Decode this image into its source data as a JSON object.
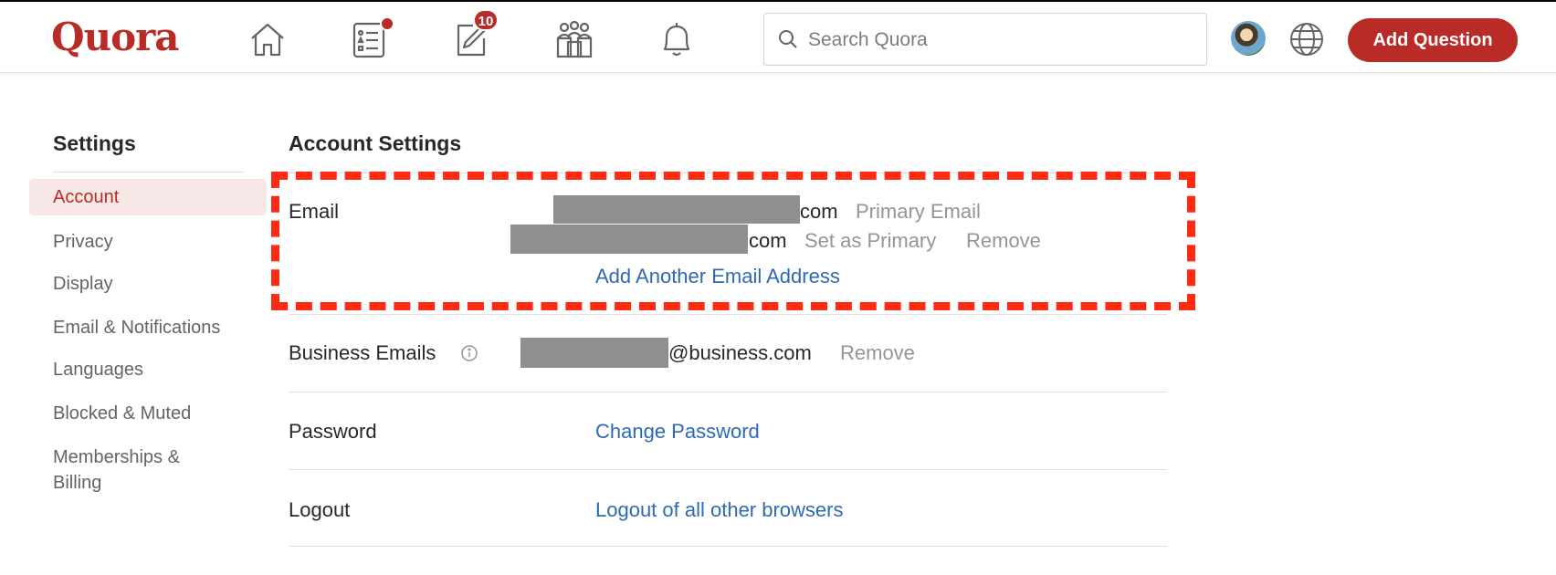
{
  "header": {
    "logo": "Quora",
    "nav": [
      {
        "name": "home",
        "icon": "home-icon"
      },
      {
        "name": "following",
        "icon": "list-icon",
        "has_dot": true
      },
      {
        "name": "answer",
        "icon": "edit-icon",
        "badge": "10"
      },
      {
        "name": "spaces",
        "icon": "people-icon"
      },
      {
        "name": "notifications",
        "icon": "bell-icon"
      }
    ],
    "search": {
      "placeholder": "Search Quora",
      "value": ""
    },
    "add_question_label": "Add Question",
    "brand_color": "#b92b27"
  },
  "sidebar": {
    "title": "Settings",
    "items": [
      {
        "label": "Account",
        "active": true
      },
      {
        "label": "Privacy",
        "active": false
      },
      {
        "label": "Display",
        "active": false
      },
      {
        "label": "Email & Notifications",
        "active": false
      },
      {
        "label": "Languages",
        "active": false
      },
      {
        "label": "Blocked & Muted",
        "active": false
      },
      {
        "label": "Memberships &",
        "label_line2": "Billing",
        "active": false
      }
    ]
  },
  "main": {
    "title": "Account Settings",
    "email": {
      "label": "Email",
      "primary_suffix": "com",
      "primary_tag": "Primary Email",
      "secondary_suffix": "com",
      "set_primary_label": "Set as Primary",
      "remove_label": "Remove",
      "add_label": "Add Another Email Address"
    },
    "business": {
      "label": "Business Emails",
      "suffix": "@business.com",
      "remove_label": "Remove"
    },
    "password": {
      "label": "Password",
      "action": "Change Password"
    },
    "logout": {
      "label": "Logout",
      "action": "Logout of all other browsers"
    }
  },
  "annotation_color": "#ff2a12",
  "link_color": "#2e69b5"
}
